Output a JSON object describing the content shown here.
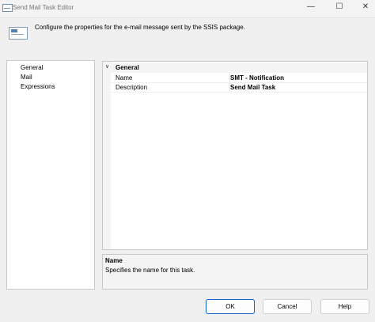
{
  "window": {
    "title": "Send Mail Task Editor",
    "controls": {
      "minimize": "—",
      "maximize": "☐",
      "close": "✕"
    }
  },
  "header": {
    "text": "Configure the properties for the e-mail message sent by the SSIS package.",
    "icon": "email-icon"
  },
  "nav": {
    "items": [
      {
        "label": "General"
      },
      {
        "label": "Mail"
      },
      {
        "label": "Expressions"
      }
    ]
  },
  "property_grid": {
    "category": {
      "label": "General",
      "chevron": "∨"
    },
    "rows": [
      {
        "name": "Name",
        "value": "SMT - Notification"
      },
      {
        "name": "Description",
        "value": "Send Mail Task"
      }
    ]
  },
  "description_pane": {
    "title": "Name",
    "text": "Specifies the name for this task."
  },
  "buttons": {
    "ok": "OK",
    "cancel": "Cancel",
    "help": "Help"
  },
  "colors": {
    "ok_border": "#0a64c8",
    "dialog_bg": "#f0f0f0"
  }
}
